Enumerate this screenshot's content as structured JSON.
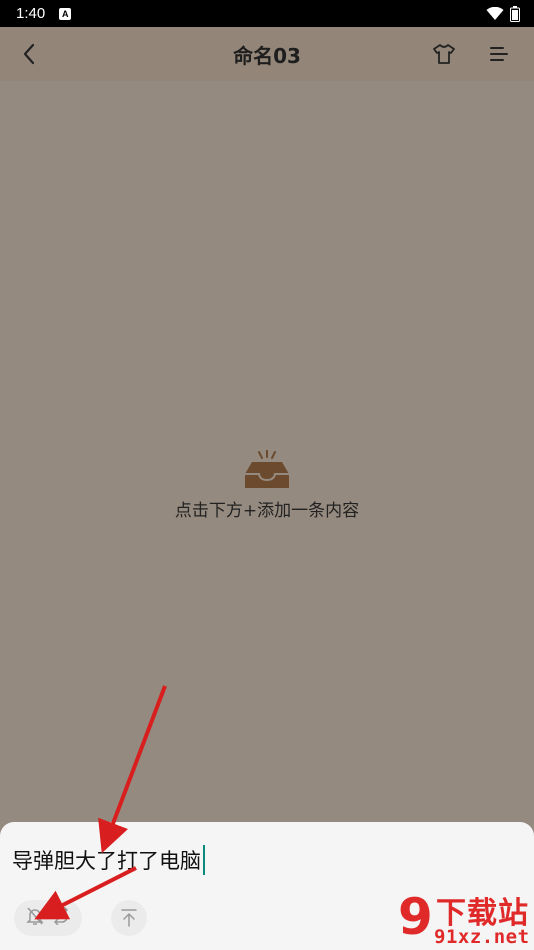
{
  "status_bar": {
    "time": "1:40",
    "app_icon_letter": "A",
    "icons": [
      "wifi-icon",
      "battery-icon"
    ]
  },
  "header": {
    "title": "命名03",
    "icons": [
      "back-icon",
      "theme-shirt-icon",
      "menu-icon"
    ]
  },
  "empty_state": {
    "icon": "empty-inbox-icon",
    "text": "点击下方+添加一条内容",
    "icon_color": "#6b4a2e"
  },
  "composer": {
    "input_value": "导弹胆大了打了电脑",
    "cursor_color": "#0a8a7a",
    "buttons": [
      "reminder-off-icon",
      "repeat-icon",
      "scroll-to-top-icon"
    ]
  },
  "watermark": {
    "line1": "下载站",
    "line2": "91xz.net",
    "color": "#e02a2a"
  },
  "colors": {
    "background": "#958a7f",
    "header": "#938679",
    "panel": "#f5f5f5",
    "annotation_arrow": "#d81e1e"
  }
}
